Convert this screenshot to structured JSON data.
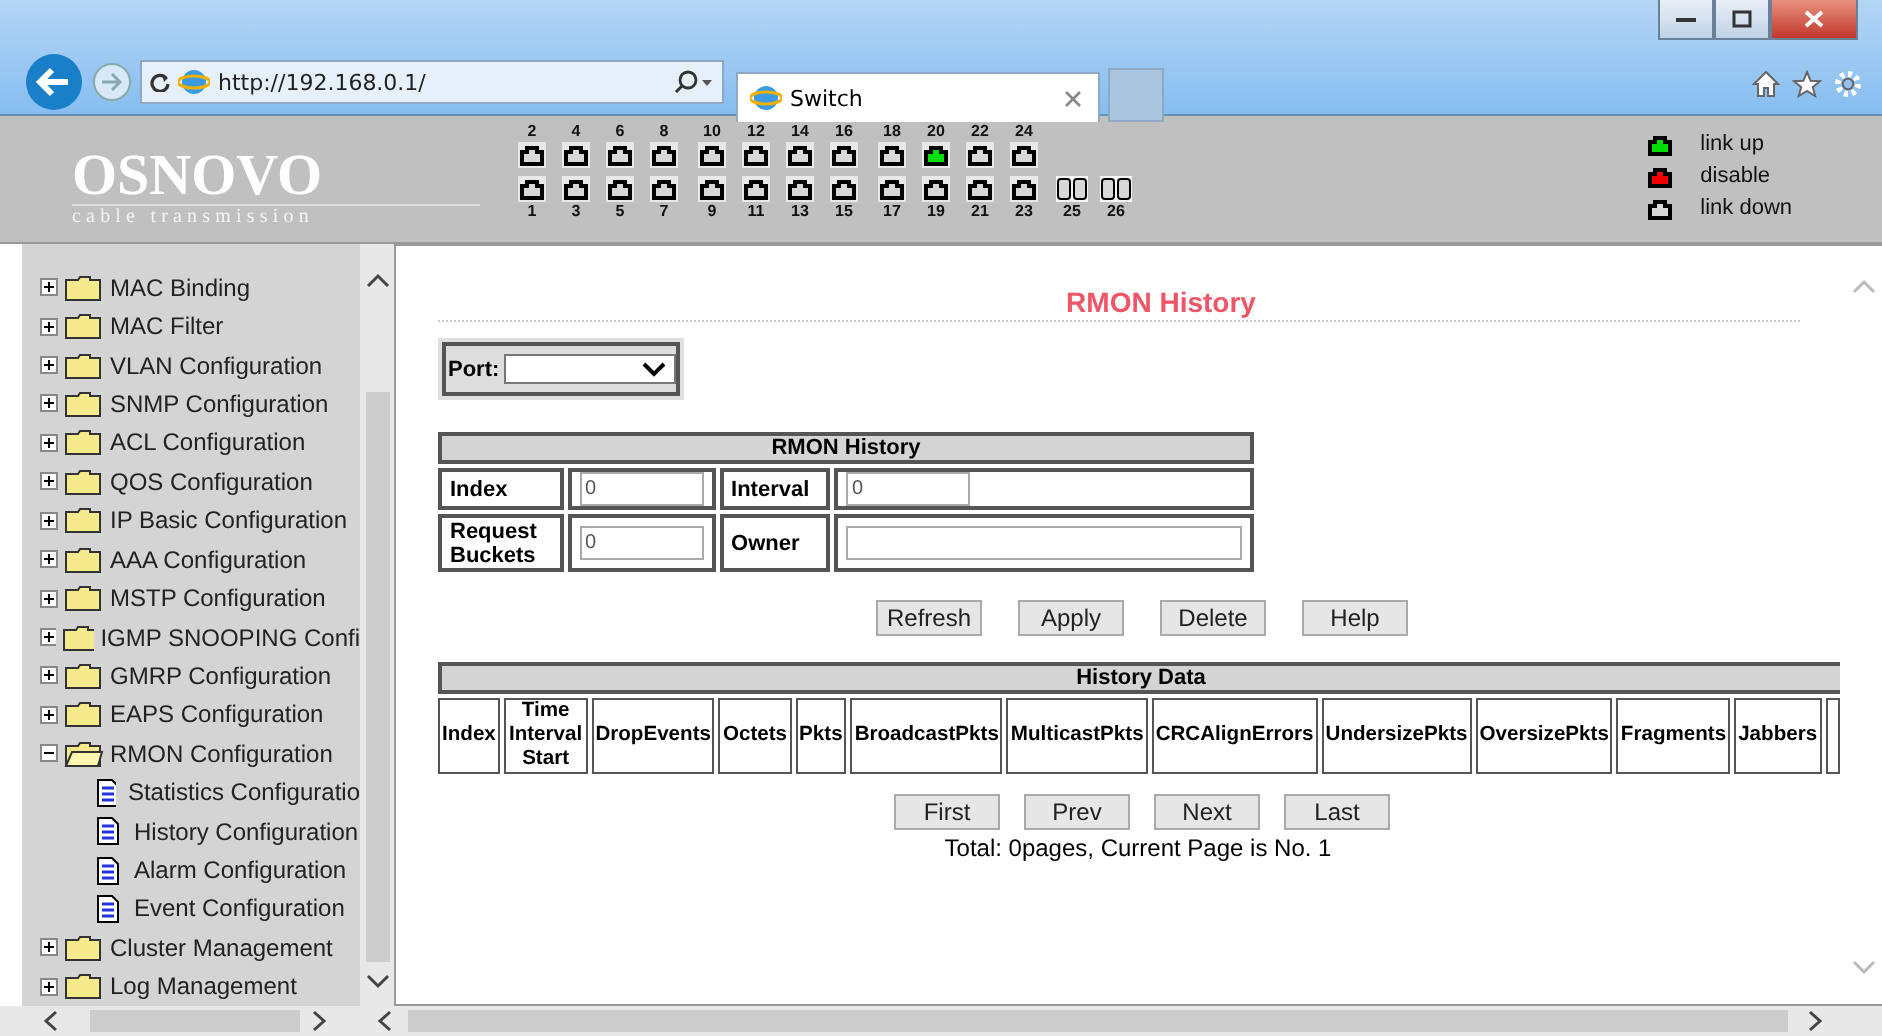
{
  "browser": {
    "url": "http://192.168.0.1/",
    "tab_title": "Switch"
  },
  "header": {
    "logo": "OSNOVO",
    "tagline": "cable transmission",
    "ports_top": [
      [
        {
          "label": "2",
          "color": "#d8d8d8"
        },
        {
          "label": "4",
          "color": "#d8d8d8"
        },
        {
          "label": "6",
          "color": "#d8d8d8"
        },
        {
          "label": "8",
          "color": "#d8d8d8"
        }
      ],
      [
        {
          "label": "10",
          "color": "#d8d8d8"
        },
        {
          "label": "12",
          "color": "#d8d8d8"
        },
        {
          "label": "14",
          "color": "#d8d8d8"
        },
        {
          "label": "16",
          "color": "#d8d8d8"
        }
      ],
      [
        {
          "label": "18",
          "color": "#d8d8d8"
        },
        {
          "label": "20",
          "color": "#00dd00"
        },
        {
          "label": "22",
          "color": "#d8d8d8"
        },
        {
          "label": "24",
          "color": "#d8d8d8"
        }
      ]
    ],
    "ports_bottom": [
      [
        {
          "label": "1",
          "color": "#d8d8d8",
          "kind": "rj45"
        },
        {
          "label": "3",
          "color": "#d8d8d8",
          "kind": "rj45"
        },
        {
          "label": "5",
          "color": "#d8d8d8",
          "kind": "rj45"
        },
        {
          "label": "7",
          "color": "#d8d8d8",
          "kind": "rj45"
        }
      ],
      [
        {
          "label": "9",
          "color": "#d8d8d8",
          "kind": "rj45"
        },
        {
          "label": "11",
          "color": "#d8d8d8",
          "kind": "rj45"
        },
        {
          "label": "13",
          "color": "#d8d8d8",
          "kind": "rj45"
        },
        {
          "label": "15",
          "color": "#d8d8d8",
          "kind": "rj45"
        }
      ],
      [
        {
          "label": "17",
          "color": "#d8d8d8",
          "kind": "rj45"
        },
        {
          "label": "19",
          "color": "#d8d8d8",
          "kind": "rj45"
        },
        {
          "label": "21",
          "color": "#d8d8d8",
          "kind": "rj45"
        },
        {
          "label": "23",
          "color": "#d8d8d8",
          "kind": "rj45"
        }
      ],
      [
        {
          "label": "25",
          "color": "#d8d8d8",
          "kind": "sfp"
        },
        {
          "label": "26",
          "color": "#d8d8d8",
          "kind": "sfp"
        }
      ]
    ],
    "legend": [
      {
        "color": "#00dd00",
        "label": "link up"
      },
      {
        "color": "#ee0000",
        "label": "disable"
      },
      {
        "color": "#d8d8d8",
        "label": "link down"
      }
    ]
  },
  "sidebar": {
    "items": [
      {
        "label": "MAC Binding",
        "expanded": false
      },
      {
        "label": "MAC Filter",
        "expanded": false
      },
      {
        "label": "VLAN Configuration",
        "expanded": false
      },
      {
        "label": "SNMP Configuration",
        "expanded": false
      },
      {
        "label": "ACL Configuration",
        "expanded": false
      },
      {
        "label": "QOS Configuration",
        "expanded": false
      },
      {
        "label": "IP Basic Configuration",
        "expanded": false
      },
      {
        "label": "AAA Configuration",
        "expanded": false
      },
      {
        "label": "MSTP Configuration",
        "expanded": false
      },
      {
        "label": "IGMP SNOOPING Confi",
        "expanded": false
      },
      {
        "label": "GMRP Configuration",
        "expanded": false
      },
      {
        "label": "EAPS Configuration",
        "expanded": false
      },
      {
        "label": "RMON Configuration",
        "expanded": true,
        "children": [
          {
            "label": "Statistics Configuratio"
          },
          {
            "label": "History Configuration"
          },
          {
            "label": "Alarm Configuration"
          },
          {
            "label": "Event Configuration"
          }
        ]
      },
      {
        "label": "Cluster Management",
        "expanded": false
      },
      {
        "label": "Log Management",
        "expanded": false
      }
    ]
  },
  "content": {
    "title": "RMON History",
    "port_label": "Port:",
    "form": {
      "title": "RMON History",
      "index_label": "Index",
      "index_value": "0",
      "interval_label": "Interval",
      "interval_value": "0",
      "buckets_label": "Request Buckets",
      "buckets_value": "0",
      "owner_label": "Owner"
    },
    "buttons": [
      "Refresh",
      "Apply",
      "Delete",
      "Help"
    ],
    "history": {
      "title": "History Data",
      "columns": [
        "Index",
        "Time Interval Start",
        "DropEvents",
        "Octets",
        "Pkts",
        "BroadcastPkts",
        "MulticastPkts",
        "CRCAlignErrors",
        "UndersizePkts",
        "OversizePkts",
        "Fragments",
        "Jabbers"
      ]
    },
    "pager": [
      "First",
      "Prev",
      "Next",
      "Last"
    ],
    "footer": "Total: 0pages, Current Page is No. 1"
  }
}
